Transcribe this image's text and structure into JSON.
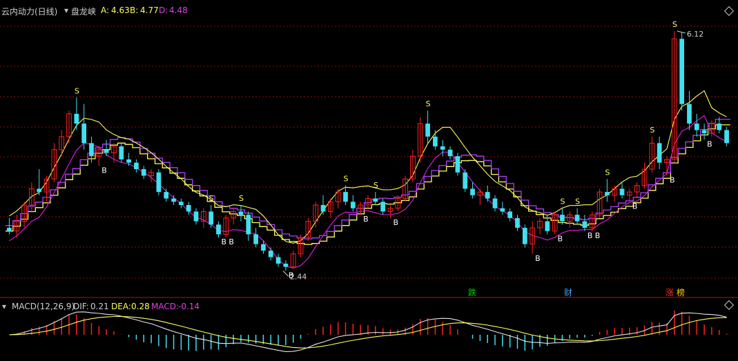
{
  "header": {
    "title": "云内动力(日线)",
    "indicator": "盘龙峡",
    "a_label": "A:",
    "a_value": "4.63",
    "b_label": "B:",
    "b_value": "4.77",
    "d_label": "D:",
    "d_value": "4.48"
  },
  "macd_header": {
    "name": "MACD(12,26,9)",
    "dif_label": "DIF:",
    "dif_value": "0.21",
    "dea_label": "DEA:",
    "dea_value": "0.28",
    "macd_label": "MACD:",
    "macd_value": "-0.14"
  },
  "annotations": {
    "high_label": "6.12",
    "low_label": "2.44",
    "buy": "B",
    "sell": "S",
    "tags": [
      {
        "text": "跌",
        "color": "#00d000"
      },
      {
        "text": "财",
        "color": "#40a0ff"
      },
      {
        "text": "涨",
        "color": "#ff3030"
      },
      {
        "text": "榜",
        "color": "#ffd000"
      }
    ]
  },
  "colors": {
    "up": "#ff2020",
    "down": "#40e0f0",
    "yellow": "#ffff60",
    "purple": "#b040ff",
    "magenta": "#e020e0",
    "grid": "#8a1010",
    "white": "#ffffff"
  },
  "chart_data": {
    "type": "candlestick",
    "ylim": [
      2.2,
      6.3
    ],
    "ohlc": [
      [
        3.1,
        3.25,
        3.0,
        3.05
      ],
      [
        3.05,
        3.3,
        2.95,
        3.2
      ],
      [
        3.2,
        3.5,
        3.1,
        3.45
      ],
      [
        3.45,
        3.8,
        3.35,
        3.7
      ],
      [
        3.7,
        4.0,
        3.6,
        3.65
      ],
      [
        3.65,
        3.9,
        3.5,
        3.85
      ],
      [
        3.85,
        4.4,
        3.8,
        4.3
      ],
      [
        4.3,
        4.6,
        4.2,
        4.5
      ],
      [
        4.5,
        4.9,
        4.4,
        4.85
      ],
      [
        4.85,
        5.1,
        4.6,
        4.7
      ],
      [
        4.7,
        5.0,
        4.3,
        4.4
      ],
      [
        4.4,
        4.5,
        4.1,
        4.2
      ],
      [
        4.2,
        4.35,
        4.05,
        4.3
      ],
      [
        4.3,
        4.45,
        4.2,
        4.25
      ],
      [
        4.25,
        4.4,
        4.1,
        4.35
      ],
      [
        4.35,
        4.4,
        4.1,
        4.15
      ],
      [
        4.15,
        4.25,
        4.05,
        4.1
      ],
      [
        4.1,
        4.15,
        3.95,
        4.0
      ],
      [
        4.0,
        4.05,
        3.85,
        3.9
      ],
      [
        3.9,
        4.0,
        3.8,
        3.95
      ],
      [
        3.95,
        4.0,
        3.6,
        3.65
      ],
      [
        3.65,
        3.7,
        3.5,
        3.55
      ],
      [
        3.55,
        3.6,
        3.45,
        3.5
      ],
      [
        3.5,
        3.55,
        3.4,
        3.45
      ],
      [
        3.45,
        3.5,
        3.3,
        3.35
      ],
      [
        3.35,
        3.4,
        3.15,
        3.2
      ],
      [
        3.2,
        3.4,
        3.1,
        3.35
      ],
      [
        3.35,
        3.45,
        3.1,
        3.15
      ],
      [
        3.15,
        3.2,
        2.95,
        3.0
      ],
      [
        3.0,
        3.3,
        2.95,
        3.25
      ],
      [
        3.25,
        3.4,
        3.15,
        3.35
      ],
      [
        3.35,
        3.45,
        3.2,
        3.3
      ],
      [
        3.3,
        3.35,
        2.9,
        3.0
      ],
      [
        3.0,
        3.1,
        2.8,
        2.85
      ],
      [
        2.85,
        2.9,
        2.7,
        2.75
      ],
      [
        2.75,
        2.8,
        2.6,
        2.65
      ],
      [
        2.65,
        2.7,
        2.5,
        2.55
      ],
      [
        2.55,
        2.6,
        2.44,
        2.5
      ],
      [
        2.5,
        2.75,
        2.48,
        2.7
      ],
      [
        2.7,
        3.0,
        2.65,
        2.95
      ],
      [
        2.95,
        3.25,
        2.9,
        3.2
      ],
      [
        3.2,
        3.5,
        3.1,
        3.45
      ],
      [
        3.45,
        3.6,
        3.3,
        3.35
      ],
      [
        3.35,
        3.55,
        3.25,
        3.5
      ],
      [
        3.5,
        3.7,
        3.4,
        3.65
      ],
      [
        3.65,
        3.75,
        3.45,
        3.5
      ],
      [
        3.5,
        3.6,
        3.35,
        3.4
      ],
      [
        3.4,
        3.5,
        3.3,
        3.45
      ],
      [
        3.45,
        3.6,
        3.4,
        3.55
      ],
      [
        3.55,
        3.65,
        3.45,
        3.5
      ],
      [
        3.5,
        3.55,
        3.3,
        3.35
      ],
      [
        3.35,
        3.45,
        3.25,
        3.4
      ],
      [
        3.4,
        3.6,
        3.35,
        3.55
      ],
      [
        3.55,
        3.9,
        3.5,
        3.85
      ],
      [
        3.85,
        4.3,
        3.8,
        4.2
      ],
      [
        4.2,
        4.8,
        4.1,
        4.7
      ],
      [
        4.7,
        4.9,
        4.4,
        4.5
      ],
      [
        4.5,
        4.6,
        4.3,
        4.35
      ],
      [
        4.35,
        4.45,
        4.2,
        4.3
      ],
      [
        4.3,
        4.35,
        4.15,
        4.2
      ],
      [
        4.2,
        4.25,
        3.9,
        3.95
      ],
      [
        3.95,
        4.0,
        3.65,
        3.7
      ],
      [
        3.7,
        3.8,
        3.55,
        3.6
      ],
      [
        3.6,
        3.7,
        3.45,
        3.65
      ],
      [
        3.65,
        3.75,
        3.5,
        3.55
      ],
      [
        3.55,
        3.6,
        3.35,
        3.4
      ],
      [
        3.4,
        3.5,
        3.3,
        3.35
      ],
      [
        3.35,
        3.4,
        3.2,
        3.25
      ],
      [
        3.25,
        3.3,
        3.05,
        3.1
      ],
      [
        3.1,
        3.15,
        2.8,
        2.85
      ],
      [
        2.85,
        3.2,
        2.7,
        3.1
      ],
      [
        3.1,
        3.25,
        3.0,
        3.2
      ],
      [
        3.2,
        3.3,
        3.0,
        3.05
      ],
      [
        3.05,
        3.35,
        3.0,
        3.3
      ],
      [
        3.3,
        3.4,
        3.15,
        3.2
      ],
      [
        3.2,
        3.35,
        3.1,
        3.3
      ],
      [
        3.3,
        3.4,
        3.15,
        3.2
      ],
      [
        3.2,
        3.3,
        3.05,
        3.1
      ],
      [
        3.1,
        3.35,
        3.05,
        3.3
      ],
      [
        3.3,
        3.7,
        3.25,
        3.65
      ],
      [
        3.65,
        3.85,
        3.5,
        3.6
      ],
      [
        3.6,
        3.75,
        3.5,
        3.7
      ],
      [
        3.7,
        3.8,
        3.55,
        3.6
      ],
      [
        3.6,
        3.7,
        3.5,
        3.65
      ],
      [
        3.65,
        3.8,
        3.55,
        3.75
      ],
      [
        3.75,
        4.1,
        3.7,
        4.0
      ],
      [
        4.0,
        4.5,
        3.95,
        4.4
      ],
      [
        4.4,
        4.5,
        4.0,
        4.1
      ],
      [
        4.1,
        4.2,
        3.9,
        4.15
      ],
      [
        4.15,
        6.12,
        4.1,
        6.0
      ],
      [
        6.0,
        6.1,
        4.9,
        5.0
      ],
      [
        5.0,
        5.2,
        4.6,
        4.7
      ],
      [
        4.7,
        4.85,
        4.5,
        4.6
      ],
      [
        4.6,
        4.7,
        4.45,
        4.55
      ],
      [
        4.55,
        4.75,
        4.5,
        4.7
      ],
      [
        4.7,
        4.8,
        4.55,
        4.6
      ],
      [
        4.6,
        4.65,
        4.35,
        4.4
      ]
    ]
  }
}
